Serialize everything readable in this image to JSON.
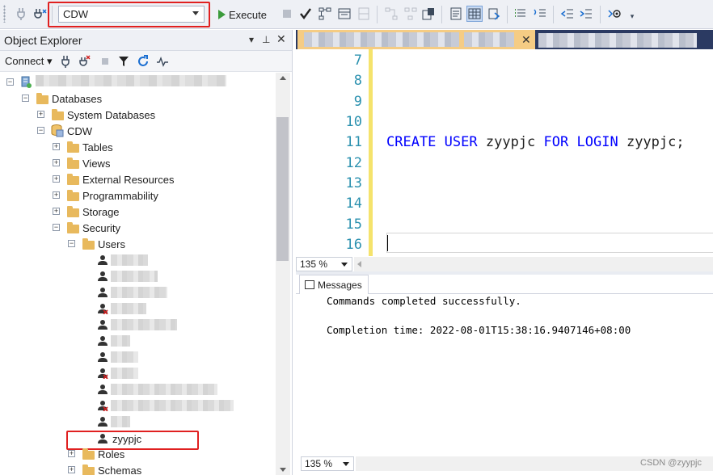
{
  "toolbar": {
    "database_selected": "CDW",
    "execute_label": "Execute"
  },
  "object_explorer": {
    "title": "Object Explorer",
    "connect_label": "Connect",
    "tree": {
      "databases": "Databases",
      "system_databases": "System Databases",
      "cdw": "CDW",
      "tables": "Tables",
      "views": "Views",
      "external_resources": "External Resources",
      "programmability": "Programmability",
      "storage": "Storage",
      "security": "Security",
      "users": "Users",
      "new_user": "zyypjc",
      "roles": "Roles",
      "schemas": "Schemas"
    }
  },
  "editor": {
    "line_numbers": [
      "7",
      "8",
      "9",
      "10",
      "11",
      "12",
      "13",
      "14",
      "15",
      "16"
    ],
    "code_line_11": {
      "kw1": "CREATE",
      "kw2": "USER",
      "user": "zyypjc",
      "kw3": "FOR",
      "kw4": "LOGIN",
      "login": "zyypjc;"
    },
    "zoom_level": "135 %"
  },
  "results": {
    "tab_label": "Messages",
    "line1": "Commands completed successfully.",
    "line2": "Completion time: 2022-08-01T15:38:16.9407146+08:00",
    "zoom_level": "135 %"
  },
  "watermark": "CSDN @zyypjc",
  "colors": {
    "highlight_box": "#e02020",
    "keyword": "#0000ff",
    "line_number": "#2b91af",
    "folder": "#e8b95d",
    "tab_active": "#f5cc84"
  }
}
